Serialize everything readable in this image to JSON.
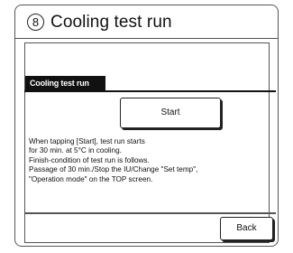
{
  "title": {
    "number": "8",
    "text": "Cooling test run"
  },
  "screen": {
    "header": "Cooling test run",
    "start_button_label": "Start",
    "description": [
      "When tapping [Start], test run starts",
      "for 30 min. at 5°C in cooling.",
      "Finish-condition of test run is follows.",
      "Passage of 30 min./Stop the IU/Change \"Set temp\",",
      "\"Operation mode\" on the TOP screen."
    ],
    "back_button_label": "Back"
  }
}
